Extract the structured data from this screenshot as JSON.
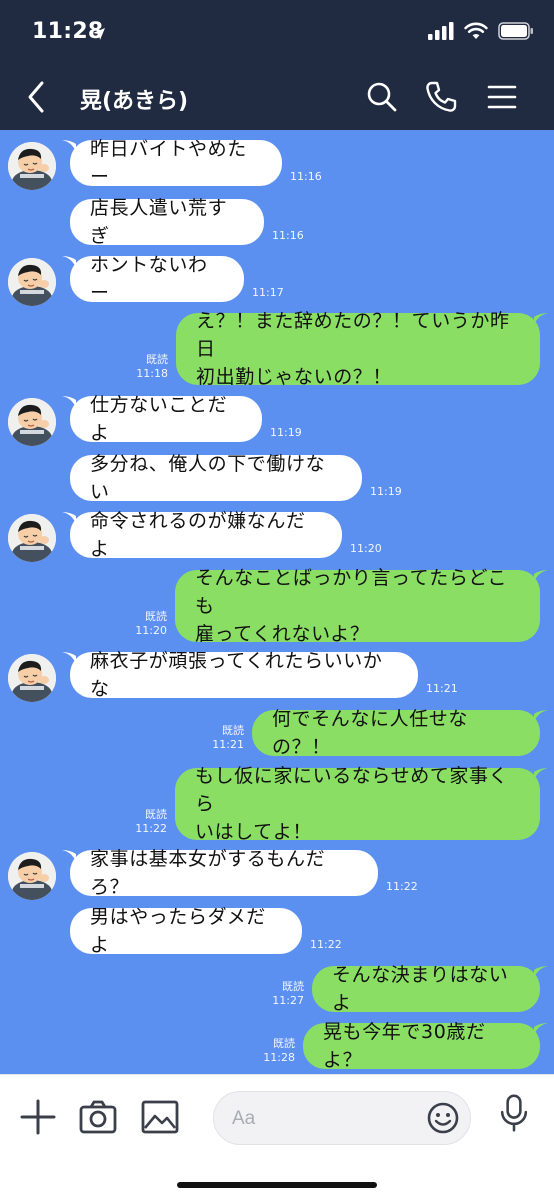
{
  "status_bar": {
    "time": "11:28",
    "location_icon": "location-arrow-icon",
    "signal_icon": "cellular-signal-icon",
    "wifi_icon": "wifi-icon",
    "battery_icon": "battery-icon"
  },
  "header": {
    "title": "晃(あきら)",
    "back_icon": "chevron-left-icon",
    "search_icon": "search-icon",
    "call_icon": "phone-icon",
    "menu_icon": "menu-icon"
  },
  "colors": {
    "header_bg": "#202a40",
    "chat_bg": "#5b8ff0",
    "incoming_bubble": "#ffffff",
    "outgoing_bubble": "#8ade64"
  },
  "messages": [
    {
      "direction": "in",
      "text": "昨日バイトやめたー",
      "time": "11:16",
      "read": "",
      "avatar": true
    },
    {
      "direction": "in",
      "text": "店長人遣い荒すぎ",
      "time": "11:16",
      "read": "",
      "avatar": false
    },
    {
      "direction": "in",
      "text": "ホントないわー",
      "time": "11:17",
      "read": "",
      "avatar": true
    },
    {
      "direction": "out",
      "text": "え？！また辞めたの？！ていうか昨日\n初出勤じゃないの？！",
      "time": "11:18",
      "read": "既読",
      "avatar": false
    },
    {
      "direction": "in",
      "text": "仕方ないことだよ",
      "time": "11:19",
      "read": "",
      "avatar": true
    },
    {
      "direction": "in",
      "text": "多分ね、俺人の下で働けない",
      "time": "11:19",
      "read": "",
      "avatar": false
    },
    {
      "direction": "in",
      "text": "命令されるのが嫌なんだよ",
      "time": "11:20",
      "read": "",
      "avatar": true
    },
    {
      "direction": "out",
      "text": "そんなことばっかり言ってたらどこも\n雇ってくれないよ？",
      "time": "11:20",
      "read": "既読",
      "avatar": false
    },
    {
      "direction": "in",
      "text": "麻衣子が頑張ってくれたらいいかな",
      "time": "11:21",
      "read": "",
      "avatar": true
    },
    {
      "direction": "out",
      "text": "何でそんなに人任せなの？！",
      "time": "11:21",
      "read": "既読",
      "avatar": false
    },
    {
      "direction": "out",
      "text": "もし仮に家にいるならせめて家事くら\nいはしてよ！",
      "time": "11:22",
      "read": "既読",
      "avatar": false
    },
    {
      "direction": "in",
      "text": "家事は基本女がするもんだろ？",
      "time": "11:22",
      "read": "",
      "avatar": true
    },
    {
      "direction": "in",
      "text": "男はやったらダメだよ",
      "time": "11:22",
      "read": "",
      "avatar": false
    },
    {
      "direction": "out",
      "text": "そんな決まりはないよ",
      "time": "11:27",
      "read": "既読",
      "avatar": false
    },
    {
      "direction": "out",
      "text": "晃も今年で30歳だよ？",
      "time": "11:28",
      "read": "既読",
      "avatar": false
    }
  ],
  "input_bar": {
    "placeholder": "Aa",
    "plus_icon": "plus-icon",
    "camera_icon": "camera-icon",
    "image_icon": "image-icon",
    "emoji_icon": "smiley-icon",
    "mic_icon": "microphone-icon"
  }
}
